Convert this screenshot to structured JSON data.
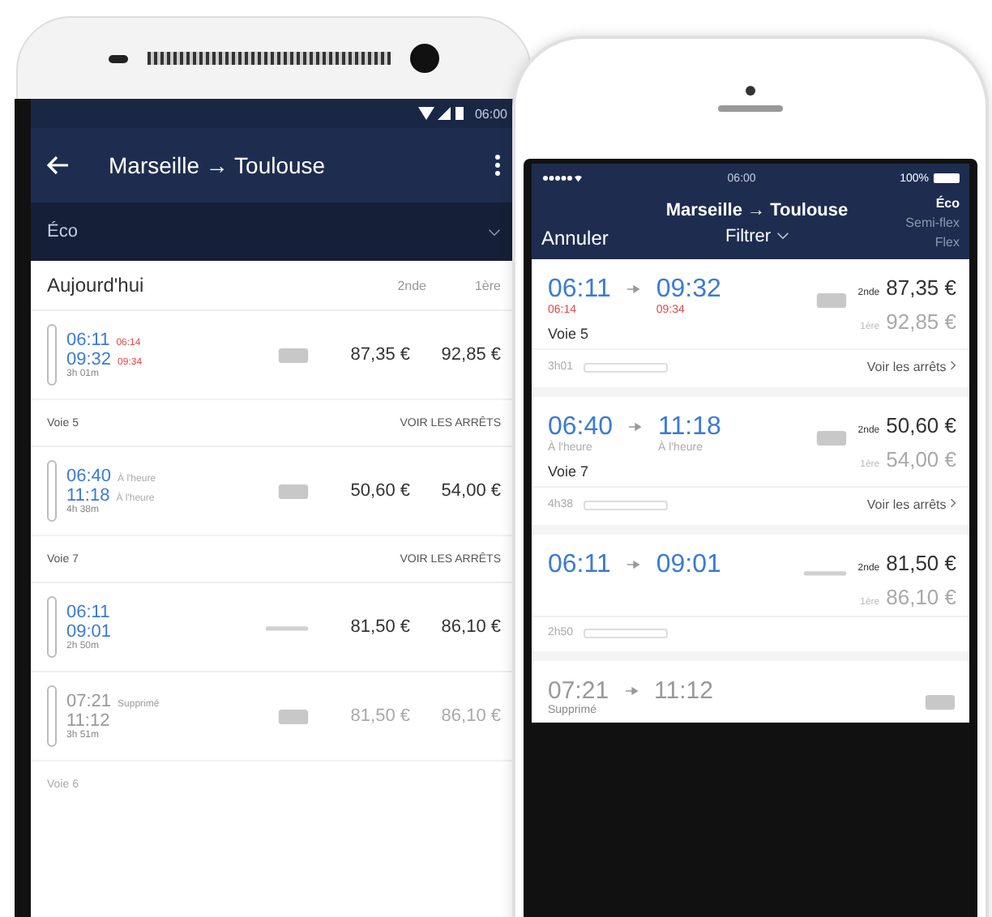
{
  "android": {
    "status_time": "06:00",
    "title": "Marseille → Toulouse",
    "fare_filter": "Éco",
    "date": "Aujourd'hui",
    "class_columns": [
      "2nde",
      "1ère"
    ],
    "journeys": [
      {
        "kind": "train",
        "cancelled": false,
        "depart": "06:11",
        "depart_note": {
          "text": "06:14",
          "kind": "delayed"
        },
        "arrive": "09:32",
        "arrive_note": {
          "text": "09:34",
          "kind": "delayed"
        },
        "duration": "3h 01m",
        "prices": [
          "87,35 €",
          "92,85 €"
        ],
        "platform": "Voie 5",
        "action": "VOIR LES ARRÊTS"
      },
      {
        "kind": "train",
        "cancelled": false,
        "depart": "06:40",
        "depart_note": {
          "text": "À l'heure",
          "kind": "ontime"
        },
        "arrive": "11:18",
        "arrive_note": {
          "text": "À l'heure",
          "kind": "ontime"
        },
        "duration": "4h 38m",
        "prices": [
          "50,60 €",
          "54,00 €"
        ],
        "platform": "Voie 7",
        "action": "VOIR LES ARRÊTS"
      },
      {
        "kind": "bus",
        "cancelled": false,
        "depart": "06:11",
        "arrive": "09:01",
        "duration": "2h 50m",
        "prices": [
          "81,50 €",
          "86,10 €"
        ]
      },
      {
        "kind": "train",
        "cancelled": true,
        "depart": "07:21",
        "depart_note": {
          "text": "Supprimé",
          "kind": "cancelled"
        },
        "arrive": "11:12",
        "duration": "3h 51m",
        "prices": [
          "81,50 €",
          "86,10 €"
        ],
        "platform": "Voie 6"
      }
    ]
  },
  "iphone": {
    "status_time": "06:00",
    "battery": "100%",
    "cancel": "Annuler",
    "title": "Marseille → Toulouse",
    "filter": "Filtrer",
    "fare_options": [
      {
        "label": "Éco",
        "selected": true
      },
      {
        "label": "Semi-flex",
        "selected": false
      },
      {
        "label": "Flex",
        "selected": false
      }
    ],
    "journeys": [
      {
        "kind": "train",
        "cancelled": false,
        "depart": "06:11",
        "depart_note": {
          "text": "06:14",
          "kind": "delayed"
        },
        "arrive": "09:32",
        "arrive_note": {
          "text": "09:34",
          "kind": "delayed"
        },
        "platform": "Voie 5",
        "duration": "3h01",
        "action": "Voir les arrêts",
        "fares": [
          {
            "class_label": "2nde",
            "price": "87,35 €"
          },
          {
            "class_label": "1ère",
            "price": "92,85 €"
          }
        ]
      },
      {
        "kind": "train",
        "cancelled": false,
        "depart": "06:40",
        "depart_note": {
          "text": "À l'heure",
          "kind": "ontime"
        },
        "arrive": "11:18",
        "arrive_note": {
          "text": "À l'heure",
          "kind": "ontime"
        },
        "platform": "Voie 7",
        "duration": "4h38",
        "action": "Voir les arrêts",
        "fares": [
          {
            "class_label": "2nde",
            "price": "50,60 €"
          },
          {
            "class_label": "1ère",
            "price": "54,00 €"
          }
        ]
      },
      {
        "kind": "bus",
        "cancelled": false,
        "depart": "06:11",
        "arrive": "09:01",
        "duration": "2h50",
        "fares": [
          {
            "class_label": "2nde",
            "price": "81,50 €"
          },
          {
            "class_label": "1ère",
            "price": "86,10 €"
          }
        ]
      },
      {
        "kind": "train",
        "cancelled": true,
        "depart": "07:21",
        "depart_note": {
          "text": "Supprimé",
          "kind": "cancelled"
        },
        "arrive": "11:12"
      }
    ]
  }
}
